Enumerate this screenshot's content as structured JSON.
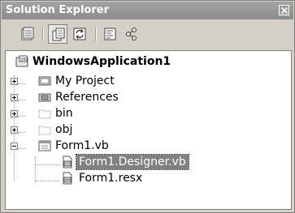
{
  "window": {
    "title": "Solution Explorer"
  },
  "toolbar": {
    "buttons": [
      {
        "name": "properties",
        "icon": "properties-icon"
      },
      {
        "name": "show-all-files",
        "icon": "show-all-files-icon",
        "pressed": true
      },
      {
        "name": "refresh",
        "icon": "refresh-icon"
      },
      {
        "name": "view-code",
        "icon": "view-code-icon"
      },
      {
        "name": "view-class-diagram",
        "icon": "view-class-diagram-icon"
      }
    ]
  },
  "tree": {
    "project": "WindowsApplication1",
    "items": [
      {
        "label": "My Project",
        "icon": "my-project-icon",
        "expandable": true
      },
      {
        "label": "References",
        "icon": "references-icon",
        "expandable": true
      },
      {
        "label": "bin",
        "icon": "folder-icon",
        "expandable": true
      },
      {
        "label": "obj",
        "icon": "folder-icon",
        "expandable": true
      },
      {
        "label": "Form1.vb",
        "icon": "form-icon",
        "expandable": true,
        "expanded": true
      },
      {
        "label": "Form1.Designer.vb",
        "icon": "vb-file-icon",
        "selected": true
      },
      {
        "label": "Form1.resx",
        "icon": "resx-file-icon"
      }
    ]
  }
}
